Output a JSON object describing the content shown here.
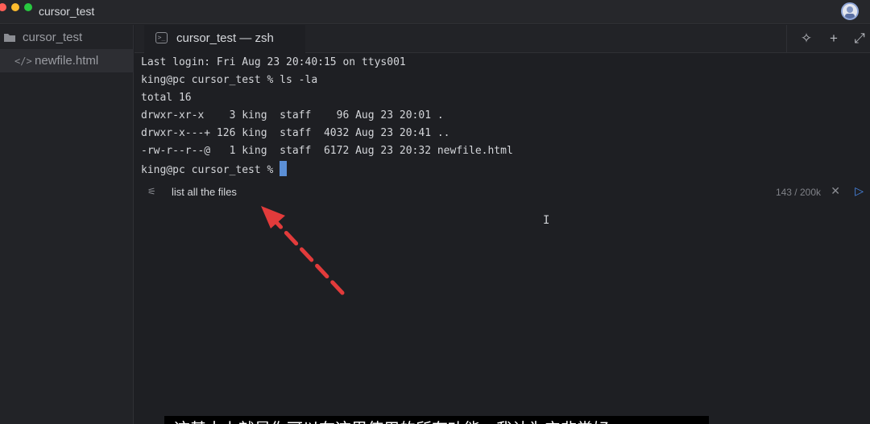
{
  "window": {
    "title": "cursor_test"
  },
  "sidebar": {
    "folder": {
      "label": "cursor_test",
      "icon": "folder-icon"
    },
    "files": [
      {
        "label": "newfile.html",
        "icon": "code-file-icon"
      }
    ]
  },
  "tab": {
    "label": "cursor_test — zsh",
    "icon": "terminal-icon"
  },
  "terminal": {
    "lines": [
      "Last login: Fri Aug 23 20:40:15 on ttys001",
      "king@pc cursor_test % ls -la",
      "total 16",
      "drwxr-xr-x    3 king  staff    96 Aug 23 20:01 .",
      "drwxr-x---+ 126 king  staff  4032 Aug 23 20:41 ..",
      "-rw-r--r--@   1 king  staff  6172 Aug 23 20:32 newfile.html",
      "king@pc cursor_test % "
    ]
  },
  "prompt": {
    "text": "list all the files",
    "count": "143 / 200k"
  },
  "subtitle": {
    "text": "这基本上就是你可以在这里使用的所有功能，我认为它非常好"
  },
  "colors": {
    "cursor": "#5b8fd6",
    "arrow": "#e23b3b",
    "send": "#4a8cf0"
  }
}
